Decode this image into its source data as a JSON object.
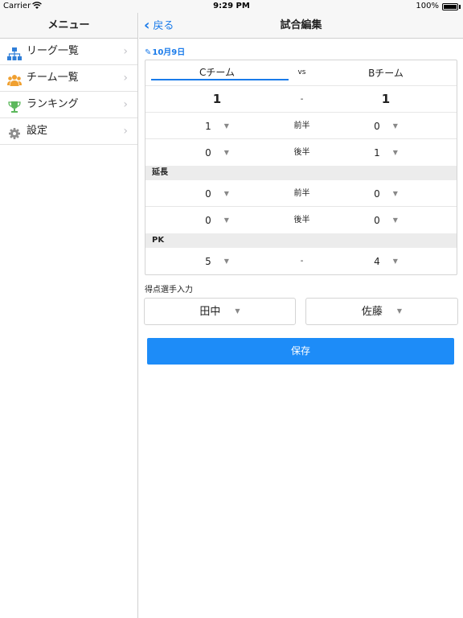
{
  "status_bar": {
    "carrier": "Carrier",
    "time": "9:29 PM",
    "battery": "100%"
  },
  "sidebar": {
    "title": "メニュー",
    "items": [
      {
        "label": "リーグ一覧",
        "icon": "hierarchy-icon",
        "icon_color": "#2f7ed8"
      },
      {
        "label": "チーム一覧",
        "icon": "users-icon",
        "icon_color": "#f0a030"
      },
      {
        "label": "ランキング",
        "icon": "trophy-icon",
        "icon_color": "#5cb85c"
      },
      {
        "label": "設定",
        "icon": "gear-icon",
        "icon_color": "#8e8e8e"
      }
    ]
  },
  "navbar": {
    "back_label": "戻る",
    "title": "試合編集"
  },
  "match": {
    "date": "10月9日",
    "home_team": "Cチーム",
    "away_team": "Bチーム",
    "vs": "vs",
    "total": {
      "home": "1",
      "sep": "-",
      "away": "1"
    },
    "first_half": {
      "home": "1",
      "label": "前半",
      "away": "0"
    },
    "second_half": {
      "home": "0",
      "label": "後半",
      "away": "1"
    },
    "extra_label": "延長",
    "extra_first": {
      "home": "0",
      "label": "前半",
      "away": "0"
    },
    "extra_second": {
      "home": "0",
      "label": "後半",
      "away": "0"
    },
    "pk_label": "PK",
    "pk": {
      "home": "5",
      "sep": "-",
      "away": "4"
    }
  },
  "scorers": {
    "label": "得点選手入力",
    "home": "田中",
    "away": "佐藤"
  },
  "save_label": "保存",
  "colors": {
    "accent": "#1a7bea",
    "button": "#1d8cf8",
    "section_bg": "#ececec"
  }
}
